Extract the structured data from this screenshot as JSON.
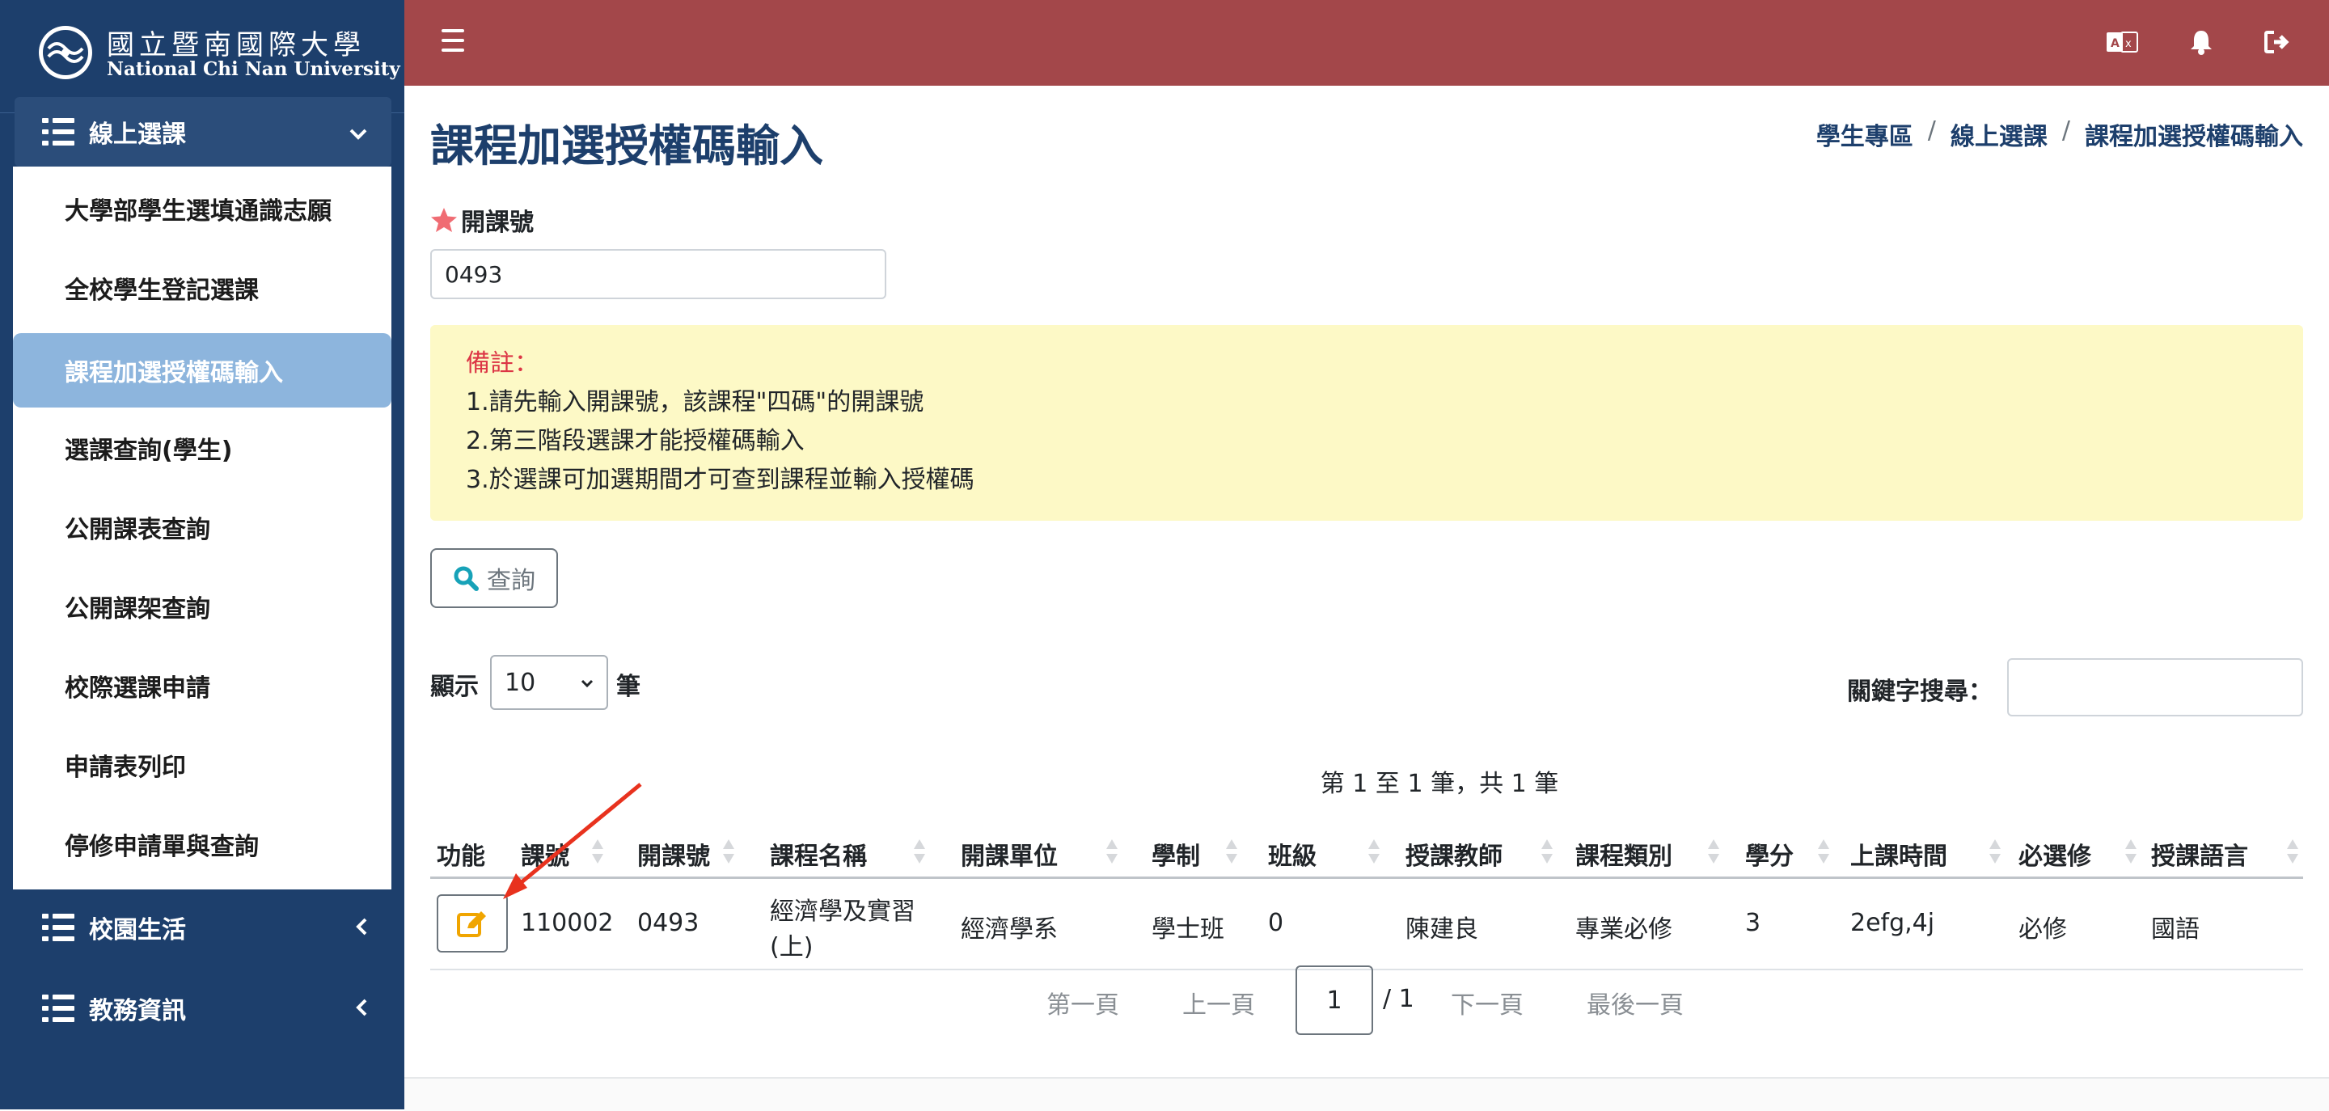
{
  "brand": {
    "name_zh": "國立暨南國際大學",
    "name_en": "National Chi Nan University"
  },
  "sidebar": {
    "open_section": "線上選課",
    "items": [
      "大學部學生選填通識志願",
      "全校學生登記選課",
      "課程加選授權碼輸入",
      "選課查詢(學生)",
      "公開課表查詢",
      "公開課架查詢",
      "校際選課申請",
      "申請表列印",
      "停修申請單與查詢"
    ],
    "active_item": "課程加選授權碼輸入",
    "sections": [
      "校園生活",
      "教務資訊"
    ]
  },
  "topbar": {
    "bg": "#a3474a",
    "icons": [
      "translate-icon",
      "bell-icon",
      "logout-icon"
    ]
  },
  "page": {
    "title": "課程加選授權碼輸入",
    "breadcrumb": [
      "學生專區",
      "線上選課",
      "課程加選授權碼輸入"
    ],
    "course_no_label": "開課號",
    "course_no_value": "0493",
    "notice": {
      "title": "備註：",
      "lines": [
        "1.請先輸入開課號，該課程\"四碼\"的開課號",
        "2.第三階段選課才能授權碼輸入",
        "3.於選課可加選期間才可查到課程並輸入授權碼"
      ]
    },
    "query_label": "查詢",
    "show_label": "顯示",
    "show_value": "10",
    "show_unit": "筆",
    "keyword_label": "關鍵字搜尋："
  },
  "table": {
    "info": "第 1 至 1 筆，共 1 筆",
    "headers": [
      "功能",
      "課號",
      "開課號",
      "課程名稱",
      "開課單位",
      "學制",
      "班級",
      "授課教師",
      "課程類別",
      "學分",
      "上課時間",
      "必選修",
      "授課語言"
    ],
    "rows": [
      {
        "course_id": "110002",
        "course_no": "0493",
        "name_line1": "經濟學及實習",
        "name_line2": "(上)",
        "unit": "經濟學系",
        "system": "學士班",
        "class": "0",
        "teacher": "陳建良",
        "category": "專業必修",
        "credits": "3",
        "time": "2efg,4j",
        "required": "必修",
        "language": "國語"
      }
    ]
  },
  "pagination": {
    "first": "第一頁",
    "prev": "上一頁",
    "current": "1",
    "total": "/ 1",
    "next": "下一頁",
    "last": "最後一頁"
  },
  "colors": {
    "sidebar": "#1d3f6c",
    "active": "#8db5dd",
    "notice": "#fdf9c6",
    "title": "#1d3f6c"
  }
}
